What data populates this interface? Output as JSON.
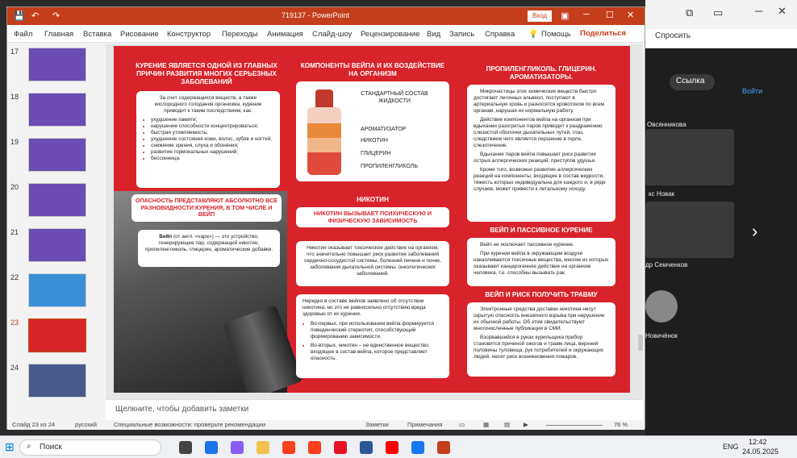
{
  "app": {
    "title": "719137 - PowerPoint",
    "signin": "Вход",
    "share": "Поделиться"
  },
  "menu": [
    "Файл",
    "Главная",
    "Вставка",
    "Рисование",
    "Конструктор",
    "Переходы",
    "Анимация",
    "Слайд-шоу",
    "Рецензирование",
    "Вид",
    "Запись",
    "Справка"
  ],
  "help": "Помощь",
  "thumbs": [
    {
      "n": "17"
    },
    {
      "n": "18"
    },
    {
      "n": "19"
    },
    {
      "n": "20"
    },
    {
      "n": "21"
    },
    {
      "n": "22"
    },
    {
      "n": "23"
    },
    {
      "n": "24"
    }
  ],
  "slide": {
    "h1": "КУРЕНИЕ ЯВЛЯЕТСЯ ОДНОЙ ИЗ ГЛАВНЫХ ПРИЧИН РАЗВИТИЯ МНОГИХ СЕРЬЕЗНЫХ ЗАБОЛЕВАНИЙ",
    "c1_intro": "За счет содержащихся веществ, а также кислородного голодания организма, курение приводит к таким последствиям, как:",
    "c1_items": [
      "ухудшение памяти;",
      "нарушение способности концентрироваться;",
      "быстрая утомляемость;",
      "ухудшение состояния кожи, волос, зубов и ногтей;",
      "снижение зрения, слуха и обоняния;",
      "развитие гормональных нарушений;",
      "бессонница."
    ],
    "danger": "ОПАСНОСТЬ ПРЕДСТАВЛЯЮТ АБСОЛЮТНО ВСЕ РАЗНОВИДНОСТИ КУРЕНИЯ, В ТОМ ЧИСЛЕ И ВЕЙП",
    "vape_bold": "Вейп",
    "vape_def": " (от англ. «vape») — это устройство, генерирующее пар, содержащий никотин, пропиленгликоль, глицерин, ароматические добавки.",
    "h2": "КОМПОНЕНТЫ ВЕЙПА И ИХ ВОЗДЕЙСТВИЕ НА ОРГАНИЗМ",
    "composition": "СТАНДАРТНЫЙ СОСТАВ ЖИДКОСТИ",
    "components": [
      "АРОМАТИЗАТОР",
      "НИКОТИН",
      "ГЛИЦЕРИН",
      "ПРОПИЛЕНГЛИКОЛЬ"
    ],
    "nic_hdr": "НИКОТИН",
    "nic_sub": "НИКОТИН ВЫЗЫВАЕТ ПСИХИЧЕСКУЮ И ФИЗИЧЕСКУЮ ЗАВИСИМОСТЬ",
    "nic_text": "Никотин оказывает токсическое действие на организм, что значительно повышает риск развития заболеваний сердечно-сосудистой системы, болезней печени и почек, заболевания дыхательной системы, онкологических заболеваний.",
    "nic2_intro": "Нередко в составе вейпов заявлено об отсутствии никотина, но это не равносильно отсутствию вреда здоровью от их курения.",
    "nic2_items": [
      "Во-первых, при использовании вейпа формируется поведенческий стереотип, способствующий формированию зависимости.",
      "Во-вторых, никотин – не единственное вещество, входящее в состав вейпа, которое представляет опасность."
    ],
    "h3": "ПРОПИЛЕНГЛИКОЛЬ. ГЛИЦЕРИН. АРОМАТИЗАТОРЫ.",
    "pg_paras": [
      "Микрочастицы этих химических веществ быстро достигают легочных альвеол, поступают в артериальную кровь и разносятся кровотоком по всем органам, нарушая их нормальную работу.",
      "Действие компонентов вейпа на организм при вдыхании разогретых паров приводит к раздражению слизистой оболочки дыхательных путей, глаз, следствием чего является першение в горле, слезотечение.",
      "Вдыхание паров вейпа повышает риск развития острых аллергических реакций, приступов удушья.",
      "Кроме того, возможно развитие аллергических реакций на компоненты, входящие в состав жидкости, тяжесть которых индивидуальна для каждого и, в ряде случаев, может привести к летальному исходу."
    ],
    "h4": "ВЕЙП И ПАССИВНОЕ КУРЕНИЕ",
    "passive": [
      "Вейп не исключает пассивное курение.",
      "При курении вейпа в окружающем воздухе накапливаются токсичные вещества, многие из которых оказывают канцерогенное действие на организм человека, т.е. способны вызывать рак."
    ],
    "h5": "ВЕЙП И РИСК ПОЛУЧИТЬ ТРАВМУ",
    "injury": [
      "Электронные средства доставки никотина несут скрытую опасность внезапного взрыва при нарушении их обычной работы. Об этом свидетельствуют многочисленные публикации в СМИ.",
      "Взорвавшийся в руках курильщика прибор становится причиной ожогов и травм лица, верхней половины туловища, рук потребителей и окружающих людей, несет риск возникновения пожаров."
    ]
  },
  "notes": "Щелкните, чтобы добавить заметки",
  "status": {
    "slide": "Слайд 23 из 24",
    "lang": "русский",
    "access": "Специальные возможности: проверьте рекомендации",
    "notes": "Заметки",
    "comments": "Примечания",
    "zoom": "76 %"
  },
  "right": {
    "share": "Спросить",
    "link": "Ссылка",
    "join": "Войти",
    "p1": "Овсянникова",
    "p2": "кс Новак",
    "p3": "др Семченков",
    "p4": "Новичёнок"
  },
  "taskbar": {
    "search": "Поиск",
    "lang": "ENG",
    "time": "12:42",
    "date": "24.05.2025"
  },
  "colors": {
    "accent": "#c43e1c",
    "slide_bg": "#d8232a"
  }
}
